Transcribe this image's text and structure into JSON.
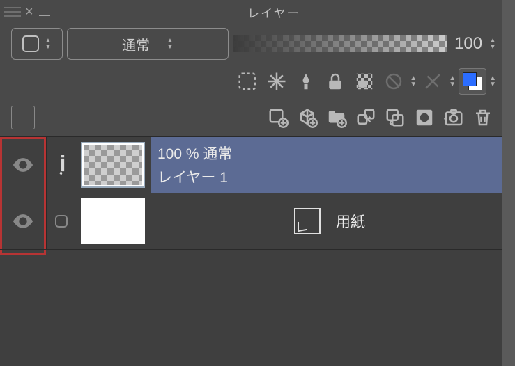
{
  "title": "レイヤー",
  "blend_mode": "通常",
  "opacity": "100",
  "toolbar1": {
    "clip_icon": "clip",
    "shine_icon": "shine",
    "ref_icon": "ref",
    "lock_icon": "lock",
    "alpha_icon": "alpha",
    "delmask_icon": "delmask",
    "maskon_icon": "maskon",
    "ruler_icon": "ruler",
    "color_icon": "color"
  },
  "toolbar2": {
    "newlayer": "new-layer",
    "newfolder3d": "new-3d",
    "folder": "folder",
    "transfer": "transfer",
    "merge": "merge",
    "mask": "mask",
    "apply": "apply",
    "trash": "trash"
  },
  "layers": [
    {
      "visible": true,
      "active_edit": true,
      "selected": true,
      "opacity_label": "100 %",
      "blend_label": "通常",
      "name": "レイヤー 1",
      "thumb": "checker"
    },
    {
      "visible": true,
      "active_edit": false,
      "selected": false,
      "name": "用紙",
      "thumb": "white",
      "is_paper": true
    }
  ]
}
